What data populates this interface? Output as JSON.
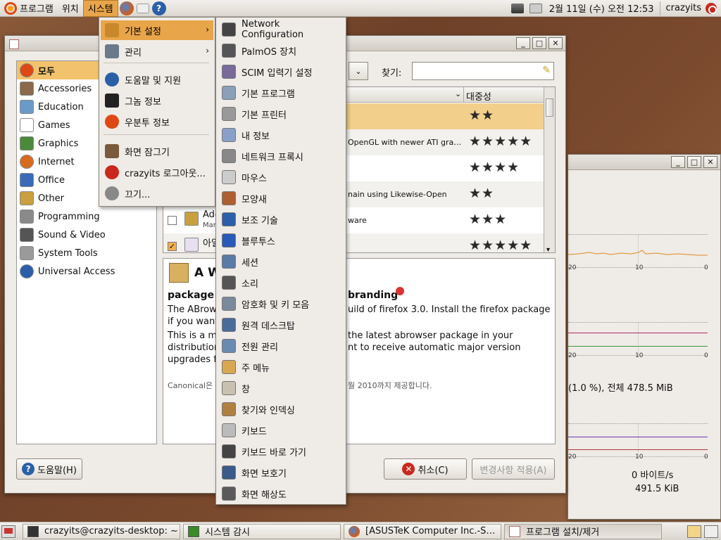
{
  "top_panel": {
    "menus": [
      "프로그램",
      "위치",
      "시스템"
    ],
    "clock": "2월 11일 (수) 오전 12:53",
    "user": "crazyits"
  },
  "system_menu": {
    "items": [
      {
        "label": "기본 설정",
        "icon": "tools-icon",
        "color": "#c9892a"
      },
      {
        "label": "관리",
        "icon": "wrench-icon",
        "color": "#6a7a8a"
      },
      {
        "label": "도움말 및 지원",
        "icon": "help-icon",
        "color": "#2b5fa8"
      },
      {
        "label": "그놈 정보",
        "icon": "gnome-foot-icon",
        "color": "#222222"
      },
      {
        "label": "우분투 정보",
        "icon": "ubuntu-icon",
        "color": "#dd4814"
      },
      {
        "label": "화면 잠그기",
        "icon": "lock-screen-icon",
        "color": "#7a5a3a"
      },
      {
        "label": "crazyits 로그아웃...",
        "icon": "logout-icon",
        "color": "#c8281e"
      },
      {
        "label": "끄기...",
        "icon": "power-icon",
        "color": "#888888"
      }
    ]
  },
  "preferences_menu": {
    "items": [
      {
        "label": "Network Configuration",
        "color": "#444444"
      },
      {
        "label": "PalmOS 장치",
        "color": "#555555"
      },
      {
        "label": "SCIM 입력기 설정",
        "color": "#7a6a9a"
      },
      {
        "label": "기본 프로그램",
        "color": "#8aa0b8"
      },
      {
        "label": "기본 프린터",
        "color": "#999999"
      },
      {
        "label": "내 정보",
        "color": "#8aa0c8"
      },
      {
        "label": "네트워크 프록시",
        "color": "#888888"
      },
      {
        "label": "마우스",
        "color": "#cccccc"
      },
      {
        "label": "모양새",
        "color": "#b06030"
      },
      {
        "label": "보조 기술",
        "color": "#2b5fa8"
      },
      {
        "label": "블루투스",
        "color": "#2a5ab8"
      },
      {
        "label": "세션",
        "color": "#5a7aa8"
      },
      {
        "label": "소리",
        "color": "#555555"
      },
      {
        "label": "암호화 및 키 모음",
        "color": "#7a8a9a"
      },
      {
        "label": "원격 데스크탑",
        "color": "#4a6a9a"
      },
      {
        "label": "전원 관리",
        "color": "#6a8ab0"
      },
      {
        "label": "주 메뉴",
        "color": "#d8a850"
      },
      {
        "label": "창",
        "color": "#c8c0b0"
      },
      {
        "label": "찾기와 인덱싱",
        "color": "#b08040"
      },
      {
        "label": "키보드",
        "color": "#bbbbbb"
      },
      {
        "label": "키보드 바로 가기",
        "color": "#444444"
      },
      {
        "label": "화면 보호기",
        "color": "#3a5a8a"
      },
      {
        "label": "화면 해상도",
        "color": "#5a5a5a"
      }
    ]
  },
  "install_window": {
    "categories": [
      {
        "label": "모두",
        "color": "#dd4814"
      },
      {
        "label": "Accessories",
        "color": "#8a6a4a"
      },
      {
        "label": "Education",
        "color": "#6a9ac8"
      },
      {
        "label": "Games",
        "color": "#ffffff"
      },
      {
        "label": "Graphics",
        "color": "#4a8a3a"
      },
      {
        "label": "Internet",
        "color": "#d86a20"
      },
      {
        "label": "Office",
        "color": "#3a6ab8"
      },
      {
        "label": "Other",
        "color": "#c8a040"
      },
      {
        "label": "Programming",
        "color": "#8a8a8a"
      },
      {
        "label": "Sound & Video",
        "color": "#555555"
      },
      {
        "label": "System Tools",
        "color": "#9a9a9a"
      },
      {
        "label": "Universal Access",
        "color": "#2b5fa8"
      }
    ],
    "search_label": "찾기:",
    "column_popularity": "대중성",
    "rows": [
      {
        "desc": "",
        "stars": "★★"
      },
      {
        "desc": "OpenGL with newer ATI gra…",
        "stars": "★★★★★"
      },
      {
        "desc": "",
        "stars": "★★★★"
      },
      {
        "desc": "nain using Likewise-Open",
        "stars": "★★"
      },
      {
        "name": "Ado",
        "sub": "Mar",
        "desc": "ware",
        "stars": "★★★"
      },
      {
        "name": "아일",
        "desc": "",
        "stars": "★★★★★"
      }
    ],
    "description": {
      "title": "A W",
      "heading_left": "package",
      "heading_right": "branding",
      "line1_left": "The ABrow",
      "line1_right": "uild of firefox 3.0. Install the firefox package",
      "line2_left": "if you want",
      "line3_left": "This is a m",
      "line3_right": "the latest abrowser package in your",
      "line4_left": "distribution",
      "line4_right": "nt to receive automatic major version",
      "line5_left": "upgrades f",
      "footer_left": "Canonical은",
      "footer_right": "월 2010까지 제공합니다."
    },
    "help_button": "도움말(H)",
    "cancel_button": "취소(C)",
    "apply_button": "변경사항 적용(A)"
  },
  "monitor_window": {
    "ticks": [
      "20",
      "10",
      "0"
    ],
    "memory_text": "(1.0 %), 전체 478.5 MiB",
    "net_rate": "0 바이트/s",
    "net_total": "491.5 KiB"
  },
  "taskbar": [
    {
      "label": "crazyits@crazyits-desktop: ~",
      "icon": "terminal-icon"
    },
    {
      "label": "시스템 감시",
      "icon": "system-monitor-icon"
    },
    {
      "label": "[ASUSTeK Computer Inc.-S…",
      "icon": "firefox-icon"
    },
    {
      "label": "프로그램 설치/제거",
      "icon": "add-remove-icon"
    }
  ]
}
